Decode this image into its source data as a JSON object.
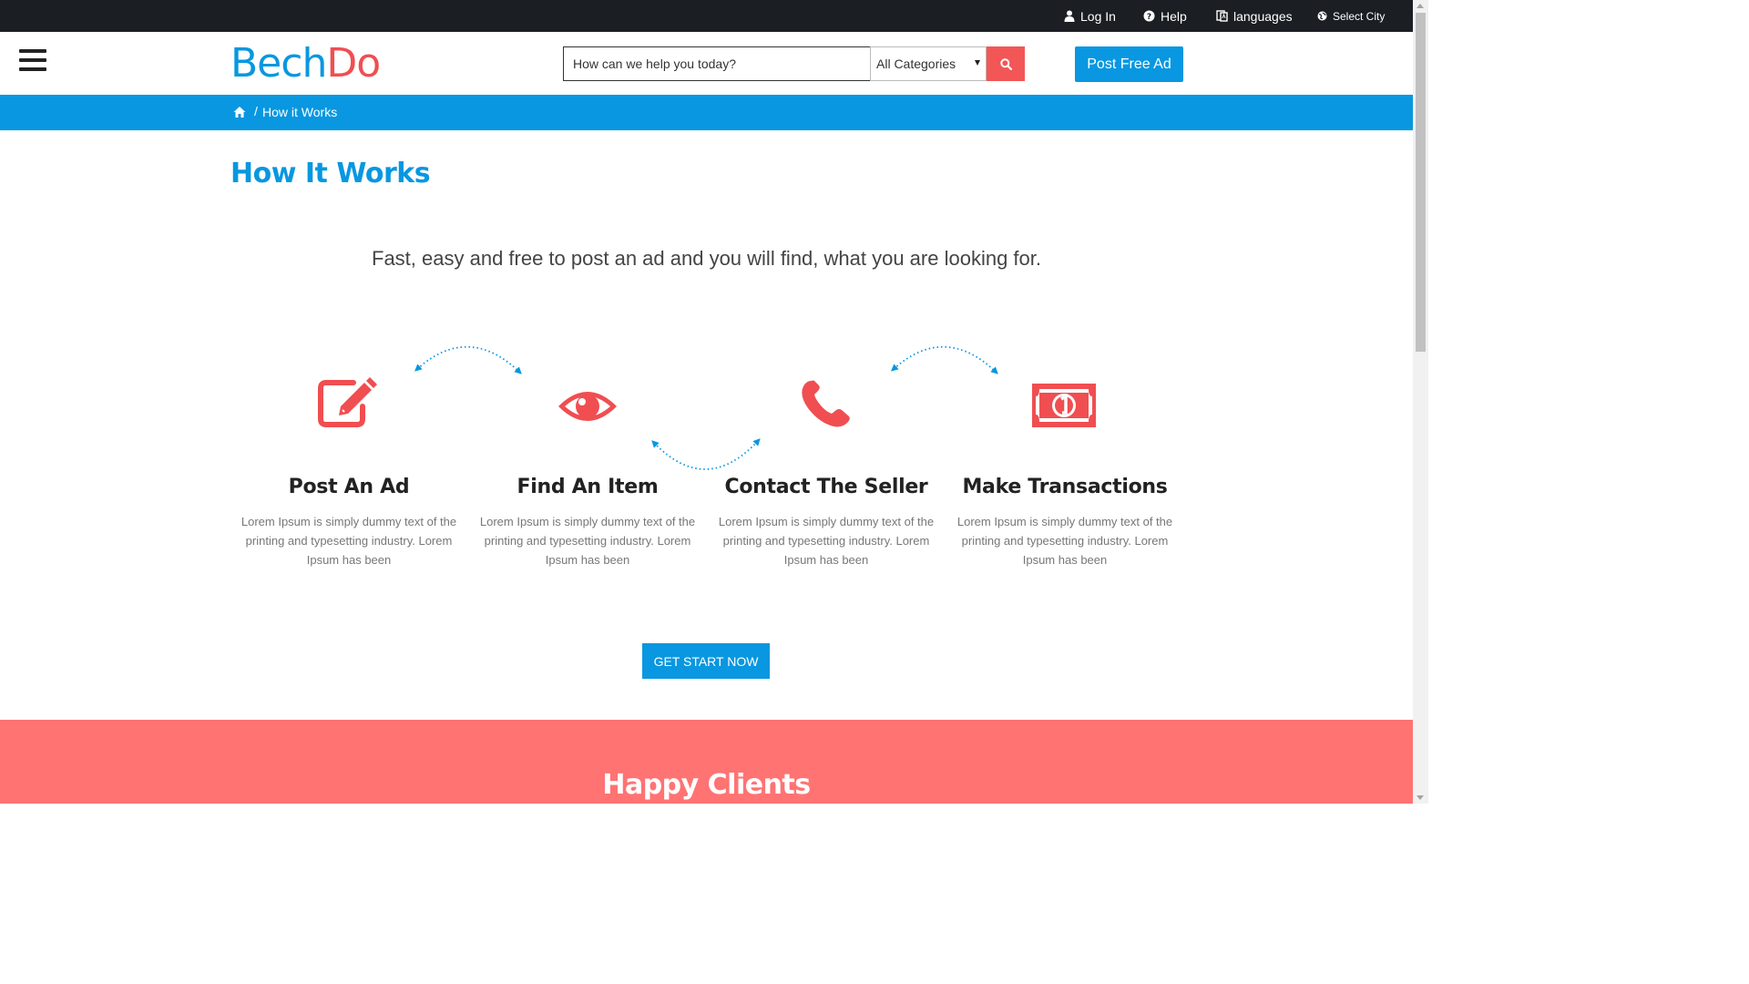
{
  "topbar": {
    "login": "Log In",
    "help": "Help",
    "languages": "languages",
    "city": "Select City"
  },
  "header": {
    "logo_part1": "Bech",
    "logo_part2": "Do",
    "search_placeholder": "How can we help you today?",
    "category_selected": "All Categories",
    "post_ad": "Post Free Ad"
  },
  "breadcrumb": {
    "separator": "/",
    "current": "How it Works"
  },
  "main": {
    "title": "How It Works",
    "subtitle": "Fast, easy and free to post an ad and you will find, what you are looking for.",
    "steps": [
      {
        "icon": "edit-icon",
        "title": "Post An Ad",
        "desc": "Lorem Ipsum is simply dummy text of the printing and typesetting industry. Lorem Ipsum has been"
      },
      {
        "icon": "eye-icon",
        "title": "Find An Item",
        "desc": "Lorem Ipsum is simply dummy text of the printing and typesetting industry. Lorem Ipsum has been"
      },
      {
        "icon": "phone-icon",
        "title": "Contact The Seller",
        "desc": "Lorem Ipsum is simply dummy text of the printing and typesetting industry. Lorem Ipsum has been"
      },
      {
        "icon": "money-icon",
        "title": "Make Transactions",
        "desc": "Lorem Ipsum is simply dummy text of the printing and typesetting industry. Lorem Ipsum has been"
      }
    ],
    "cta": "GET START NOW"
  },
  "clients": {
    "title": "Happy Clients"
  },
  "colors": {
    "brand_blue": "#0897e0",
    "brand_red": "#f04e51",
    "topbar": "#1b1f23",
    "clients_bg": "#ff7373"
  }
}
